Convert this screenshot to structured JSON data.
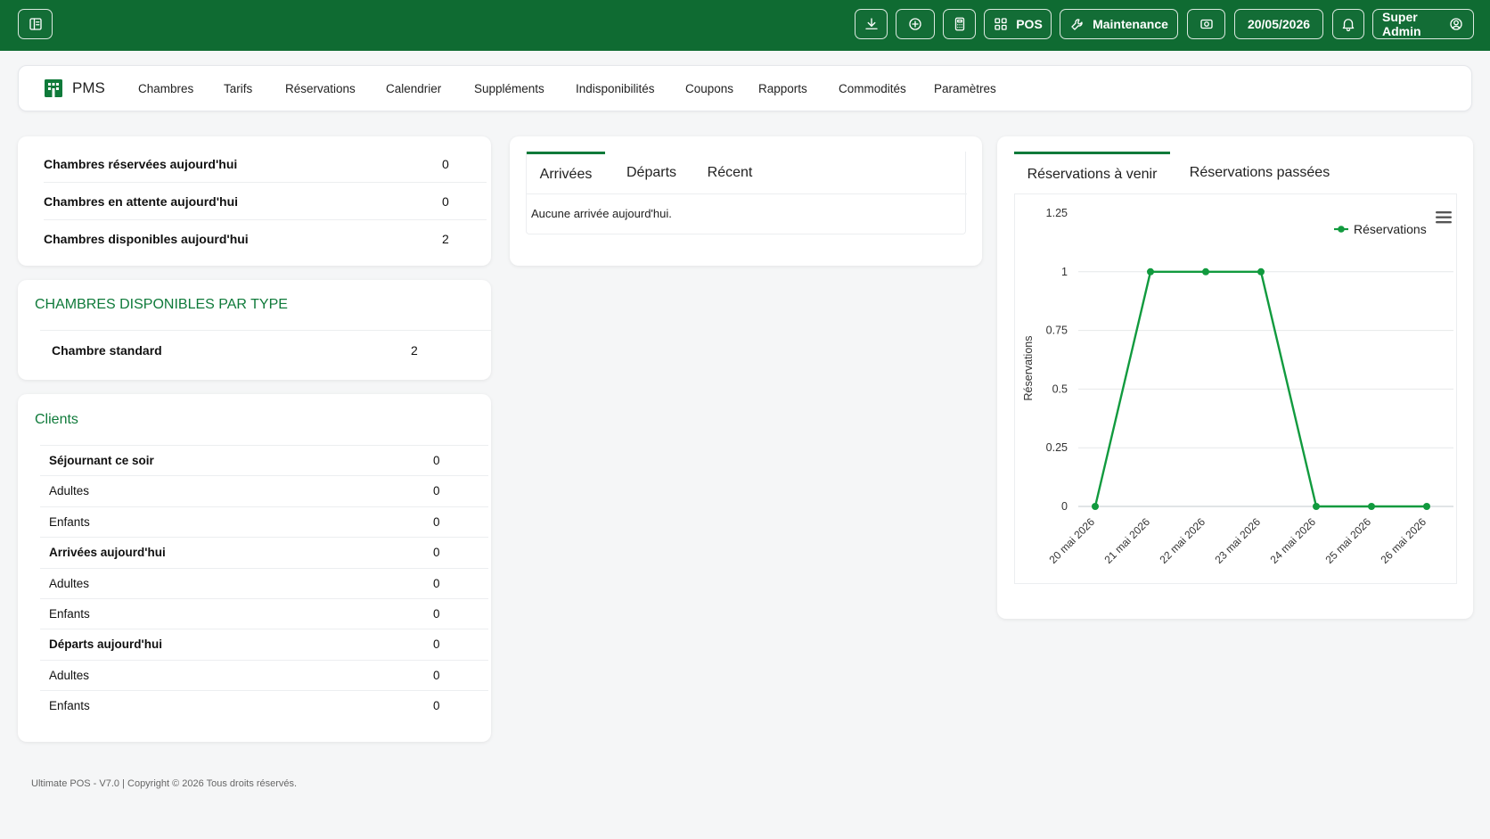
{
  "topbar": {
    "pos_label": "POS",
    "maintenance_label": "Maintenance",
    "date": "20/05/2026",
    "user": "Super Admin",
    "icons": [
      "sidebar-toggle-icon",
      "download-icon",
      "plus-circle-icon",
      "calculator-icon",
      "grid-icon",
      "wrench-icon",
      "camera-icon",
      "bell-icon",
      "user-circle-icon"
    ]
  },
  "nav": {
    "brand": "PMS",
    "items": [
      "Chambres",
      "Tarifs",
      "Réservations",
      "Calendrier",
      "Suppléments",
      "Indisponibilités",
      "Coupons",
      "Rapports",
      "Commodités",
      "Paramètres"
    ]
  },
  "summary": {
    "rows": [
      {
        "label": "Chambres réservées aujourd'hui",
        "value": "0"
      },
      {
        "label": "Chambres en attente aujourd'hui",
        "value": "0"
      },
      {
        "label": "Chambres disponibles aujourd'hui",
        "value": "2"
      }
    ]
  },
  "room_types": {
    "title": "CHAMBRES DISPONIBLES PAR TYPE",
    "rows": [
      {
        "label": "Chambre standard",
        "value": "2"
      }
    ]
  },
  "clients": {
    "title": "Clients",
    "rows": [
      {
        "label": "Séjournant ce soir",
        "value": "0",
        "bold": true
      },
      {
        "label": "Adultes",
        "value": "0",
        "bold": false
      },
      {
        "label": "Enfants",
        "value": "0",
        "bold": false
      },
      {
        "label": "Arrivées aujourd'hui",
        "value": "0",
        "bold": true
      },
      {
        "label": "Adultes",
        "value": "0",
        "bold": false
      },
      {
        "label": "Enfants",
        "value": "0",
        "bold": false
      },
      {
        "label": "Départs aujourd'hui",
        "value": "0",
        "bold": true
      },
      {
        "label": "Adultes",
        "value": "0",
        "bold": false
      },
      {
        "label": "Enfants",
        "value": "0",
        "bold": false
      }
    ]
  },
  "arrivals": {
    "tabs": [
      "Arrivées",
      "Départs",
      "Récent"
    ],
    "active_tab": "Arrivées",
    "empty_message": "Aucune arrivée aujourd'hui."
  },
  "reservations": {
    "tabs": [
      "Réservations à venir",
      "Réservations passées"
    ],
    "active_tab": "Réservations à venir"
  },
  "chart_data": {
    "type": "line",
    "title": "",
    "xlabel": "",
    "ylabel": "Réservations",
    "categories": [
      "20 mai 2026",
      "21 mai 2026",
      "22 mai 2026",
      "23 mai 2026",
      "24 mai 2026",
      "25 mai 2026",
      "26 mai 2026"
    ],
    "series": [
      {
        "name": "Réservations",
        "values": [
          0,
          1,
          1,
          1,
          0,
          0,
          0
        ],
        "color": "#119a3e"
      }
    ],
    "ylim": [
      0,
      1.25
    ],
    "yticks": [
      "0",
      "0.25",
      "0.5",
      "0.75",
      "1",
      "1.25"
    ],
    "grid": true,
    "legend_position": "top-right"
  },
  "footer": {
    "text": "Ultimate POS - V7.0 | Copyright © 2026 Tous droits réservés."
  },
  "colors": {
    "topbar": "#0f6b32",
    "accent": "#0f7a3a",
    "line": "#119a3e"
  }
}
